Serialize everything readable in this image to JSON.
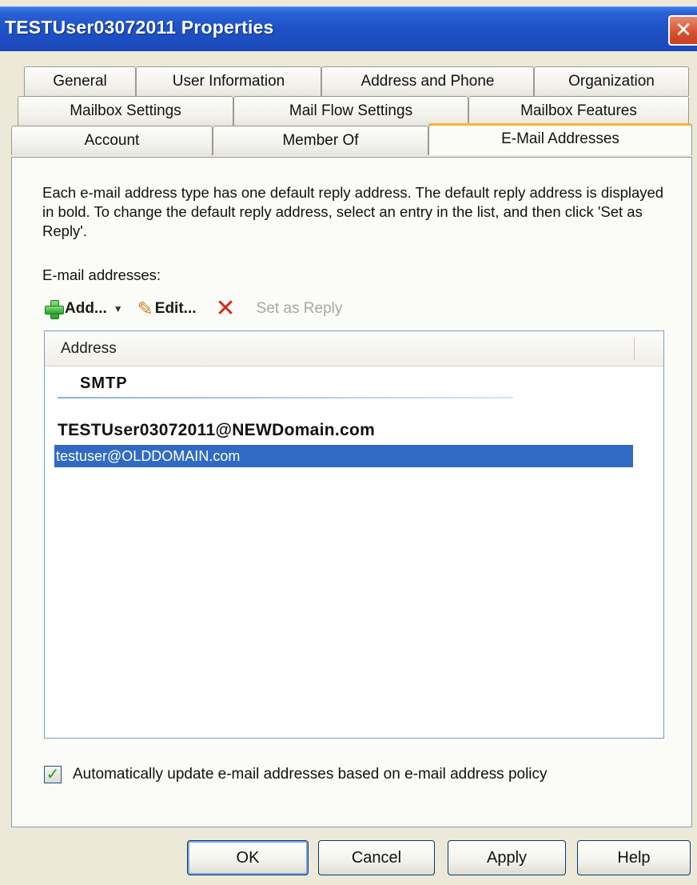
{
  "window": {
    "title": "TESTUser03072011 Properties",
    "close_glyph": "✕"
  },
  "tabs": {
    "row1": [
      "General",
      "User Information",
      "Address and Phone",
      "Organization"
    ],
    "row2": [
      "Mailbox Settings",
      "Mail Flow Settings",
      "Mailbox Features"
    ],
    "row3": [
      "Account",
      "Member Of",
      "E-Mail Addresses"
    ],
    "active": "E-Mail Addresses"
  },
  "content": {
    "description": "Each e-mail address type has one default reply address. The default reply address is displayed in bold. To change the default reply address, select an entry in the list, and then click 'Set as Reply'.",
    "addresses_label": "E-mail addresses:"
  },
  "toolbar": {
    "add_label": "Add...",
    "dropdown_glyph": "▼",
    "edit_label": "Edit...",
    "pencil_glyph": "✎",
    "delete_glyph": "✕",
    "set_reply_label": "Set as Reply"
  },
  "list": {
    "column_header": "Address",
    "group": "SMTP",
    "primary_address": "TESTUser03072011@NEWDomain.com",
    "selected_address": "testuser@OLDDOMAIN.com"
  },
  "policy": {
    "checked": true,
    "check_glyph": "✓",
    "label": "Automatically update e-mail addresses based on e-mail address policy"
  },
  "buttons": {
    "ok": "OK",
    "cancel": "Cancel",
    "apply": "Apply",
    "help": "Help"
  },
  "colors": {
    "titlebar": "#1f52c8",
    "selection": "#316ac5",
    "active_tab_accent": "#f7b430",
    "close_button": "#d6502d"
  }
}
